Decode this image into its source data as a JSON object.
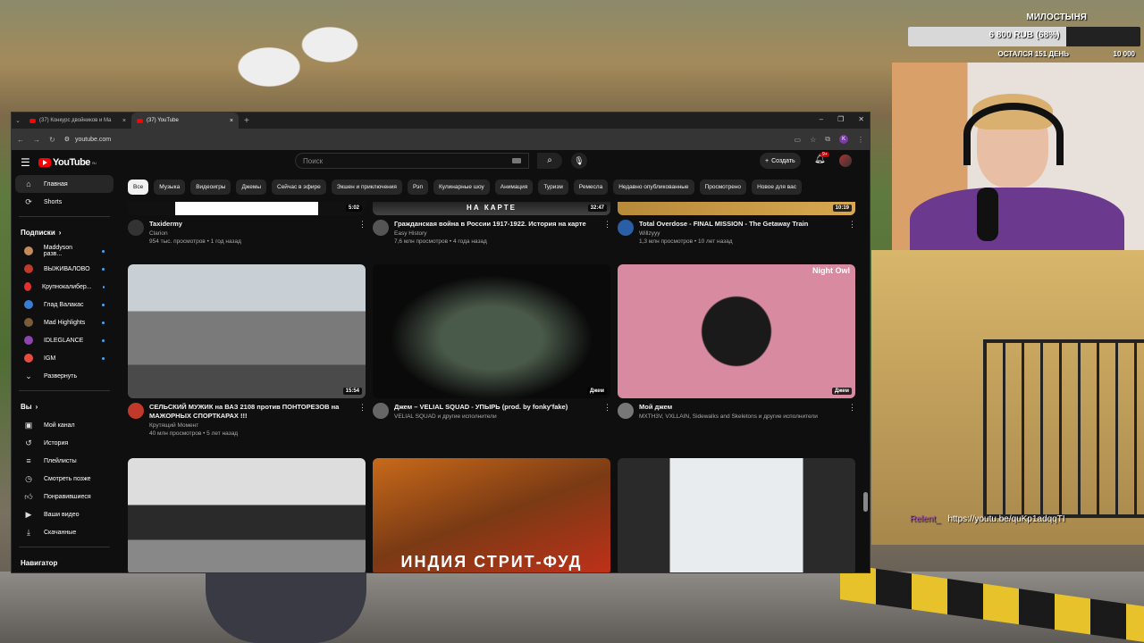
{
  "donation": {
    "title": "МИЛОСТЫНЯ",
    "amount": "6 800 RUB (68%)",
    "progress": 0.68,
    "left": "ОСТАЛСЯ 151 ДЕНЬ",
    "goal": "10 000"
  },
  "chat": {
    "user": "Relent_",
    "message": "https://youtu.be/quKp1adqqTI"
  },
  "browser": {
    "tabs": [
      {
        "label": "(37) Конкурс двойников и Ма"
      },
      {
        "label": "(37) YouTube"
      }
    ],
    "url": "youtube.com"
  },
  "youtube": {
    "logo": "YouTube",
    "region": "RU",
    "search_placeholder": "Поиск",
    "create_label": "Создать",
    "notifications": "9+",
    "sidebar": {
      "main": [
        {
          "label": "Главная"
        },
        {
          "label": "Shorts"
        }
      ],
      "subs_title": "Подписки",
      "subs": [
        {
          "label": "Maddyson разв...",
          "color": "#c48b5a"
        },
        {
          "label": "ВЫЖИВАЛОВО",
          "color": "#c0392b"
        },
        {
          "label": "Крупнокалибер...",
          "color": "#e03030"
        },
        {
          "label": "Глад Валакас",
          "color": "#3a7bd5"
        },
        {
          "label": "Mad Highlights",
          "color": "#7a5c3a"
        },
        {
          "label": "IDLEGLANCE",
          "color": "#8e44ad"
        },
        {
          "label": "IGM",
          "color": "#e74c3c"
        }
      ],
      "expand": "Развернуть",
      "you_title": "Вы",
      "you": [
        {
          "label": "Мой канал"
        },
        {
          "label": "История"
        },
        {
          "label": "Плейлисты"
        },
        {
          "label": "Смотреть позже"
        },
        {
          "label": "Понравившиеся"
        },
        {
          "label": "Ваши видео"
        },
        {
          "label": "Скачанные"
        }
      ],
      "nav_title": "Навигатор"
    },
    "chips": [
      "Все",
      "Музыка",
      "Видеоигры",
      "Джемы",
      "Сейчас в эфире",
      "Экшен и приключения",
      "Рэп",
      "Кулинарные шоу",
      "Анимация",
      "Туризм",
      "Ремесла",
      "Недавно опубликованные",
      "Просмотрено",
      "Новое для вас"
    ],
    "videos": [
      {
        "title": "Taxidermy",
        "channel": "Clarion",
        "stats": "954 тыс. просмотров • 1 год назад",
        "duration": "5:02"
      },
      {
        "title": "Гражданская война в России 1917-1922. История на карте",
        "channel": "Easy History",
        "stats": "7,6 млн просмотров • 4 года назад",
        "duration": "32:47",
        "overlay": "НА КАРТЕ"
      },
      {
        "title": "Total Overdose - FINAL MISSION - The Getaway Train",
        "channel": "Willzyyy",
        "stats": "1,3 млн просмотров • 10 лет назад",
        "duration": "10:19"
      },
      {
        "title": "СЕЛЬСКИЙ МУЖИК на ВАЗ 2108 против ПОНТОРЕЗОВ на МАЖОРНЫХ СПОРТКАРАХ !!!",
        "channel": "Крутящий Момент",
        "stats": "40 млн просмотров • 5 лет назад",
        "duration": "15:54"
      },
      {
        "title": "Джем – VELIAL SQUAD - УПЫРЬ (prod. by fonky'fake)",
        "channel": "VELIAL SQUAD и другие исполнители",
        "stats": "",
        "duration": "Джем"
      },
      {
        "title": "Мой джем",
        "channel": "MXTH3V, VXLLAIN, Sidewalks and Skeletons и другие исполнители",
        "stats": "",
        "duration": "Джем",
        "overlay": "Night Owl"
      },
      {
        "title": "",
        "channel": "",
        "stats": "",
        "duration": ""
      },
      {
        "title": "",
        "channel": "",
        "stats": "",
        "duration": "",
        "overlay": "ИНДИЯ СТРИТ-ФУД"
      },
      {
        "title": "",
        "channel": "",
        "stats": "",
        "duration": ""
      }
    ]
  }
}
